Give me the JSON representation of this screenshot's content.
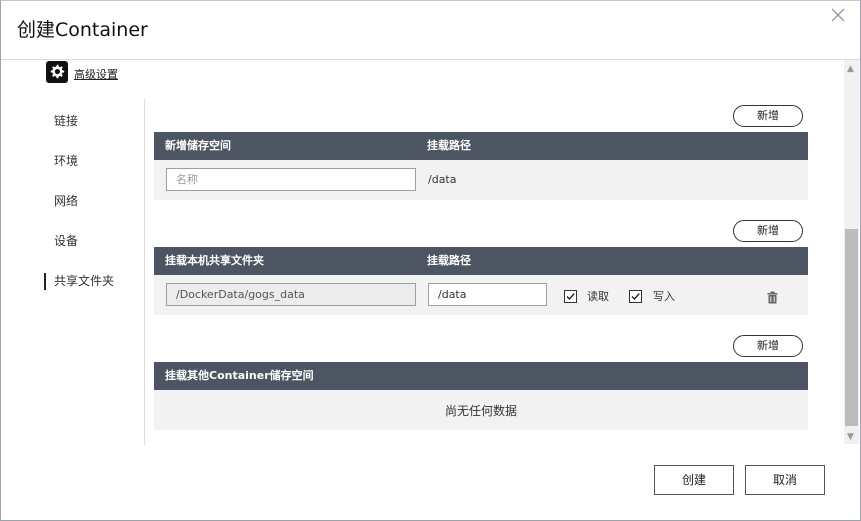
{
  "window": {
    "title": "创建Container",
    "close_icon": "close-icon"
  },
  "advanced": {
    "label": "高级设置",
    "icon": "gear-icon"
  },
  "nav": {
    "items": [
      {
        "label": "链接"
      },
      {
        "label": "环境"
      },
      {
        "label": "网络"
      },
      {
        "label": "设备"
      },
      {
        "label": "共享文件夹",
        "active": true
      }
    ]
  },
  "sections": {
    "new_storage": {
      "add_label": "新增",
      "col1": "新增储存空间",
      "col2": "挂载路径",
      "name_placeholder": "名称",
      "name_value": "",
      "mount_path": "/data"
    },
    "host_share": {
      "add_label": "新增",
      "col1": "挂载本机共享文件夹",
      "col2": "挂载路径",
      "folder_value": "/DockerData/gogs_data",
      "mount_value": "/data",
      "read_label": "读取",
      "read_checked": true,
      "write_label": "写入",
      "write_checked": true,
      "delete_icon": "trash-icon"
    },
    "container_storage": {
      "add_label": "新增",
      "col1": "挂载其他Container储存空间",
      "empty_text": "尚无任何数据"
    }
  },
  "footer": {
    "create_label": "创建",
    "cancel_label": "取消"
  },
  "colors": {
    "section_header": "#4d5563",
    "section_body": "#f2f2f2"
  }
}
